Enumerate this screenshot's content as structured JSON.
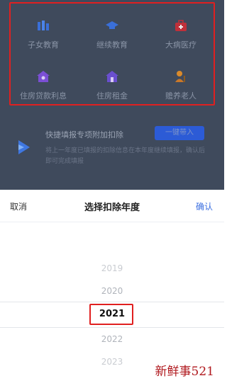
{
  "grid_items": [
    {
      "label": "子女教育",
      "icon": "children-education-icon"
    },
    {
      "label": "继续教育",
      "icon": "graduation-cap-icon"
    },
    {
      "label": "大病医疗",
      "icon": "medical-kit-icon"
    },
    {
      "label": "住房贷款利息",
      "icon": "house-loan-icon"
    },
    {
      "label": "住房租金",
      "icon": "house-rent-icon"
    },
    {
      "label": "赡养老人",
      "icon": "elderly-care-icon"
    }
  ],
  "quick_fill": {
    "title": "快捷填报专项附加扣除",
    "button": "一键带入",
    "description": "将上一年度已填报的扣除信息在本年度继续填报，确认后即可完成填报"
  },
  "picker": {
    "cancel": "取消",
    "title": "选择扣除年度",
    "confirm": "确认",
    "years": [
      "2019",
      "2020",
      "2021",
      "2022",
      "2023"
    ],
    "selected": "2021"
  },
  "watermark": "新鲜事521",
  "colors": {
    "accent": "#3b6fe0",
    "highlight_border": "#e02020",
    "overlay": "#3f4a5c"
  }
}
